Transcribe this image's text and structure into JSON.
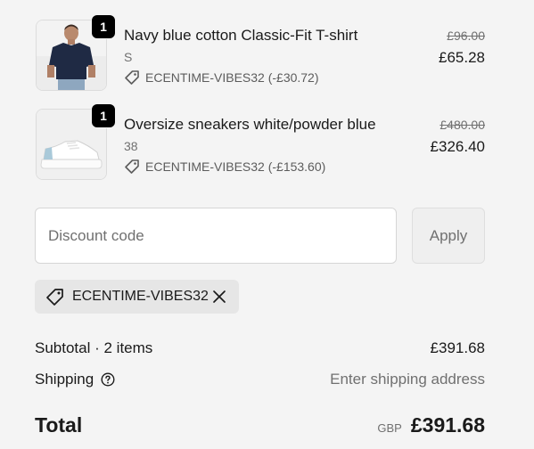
{
  "items": [
    {
      "quantity": "1",
      "name": "Navy blue cotton Classic-Fit T-shirt",
      "variant": "S",
      "discount": "ECENTIME-VIBES32 (-£30.72)",
      "original_price": "£96.00",
      "price": "£65.28",
      "image": "navy-tshirt-photo"
    },
    {
      "quantity": "1",
      "name": "Oversize sneakers white/powder blue",
      "variant": "38",
      "discount": "ECENTIME-VIBES32 (-£153.60)",
      "original_price": "£480.00",
      "price": "£326.40",
      "image": "sneaker-photo"
    }
  ],
  "discount": {
    "placeholder": "Discount code",
    "apply_label": "Apply",
    "applied_code": "ECENTIME-VIBES32"
  },
  "summary": {
    "subtotal_label": "Subtotal · 2 items",
    "subtotal_value": "£391.68",
    "shipping_label": "Shipping",
    "shipping_value": "Enter shipping address",
    "total_label": "Total",
    "currency": "GBP",
    "total_value": "£391.68"
  },
  "colors": {
    "background": "#f4f4f4",
    "badge": "#000000",
    "muted_text": "#707070"
  }
}
